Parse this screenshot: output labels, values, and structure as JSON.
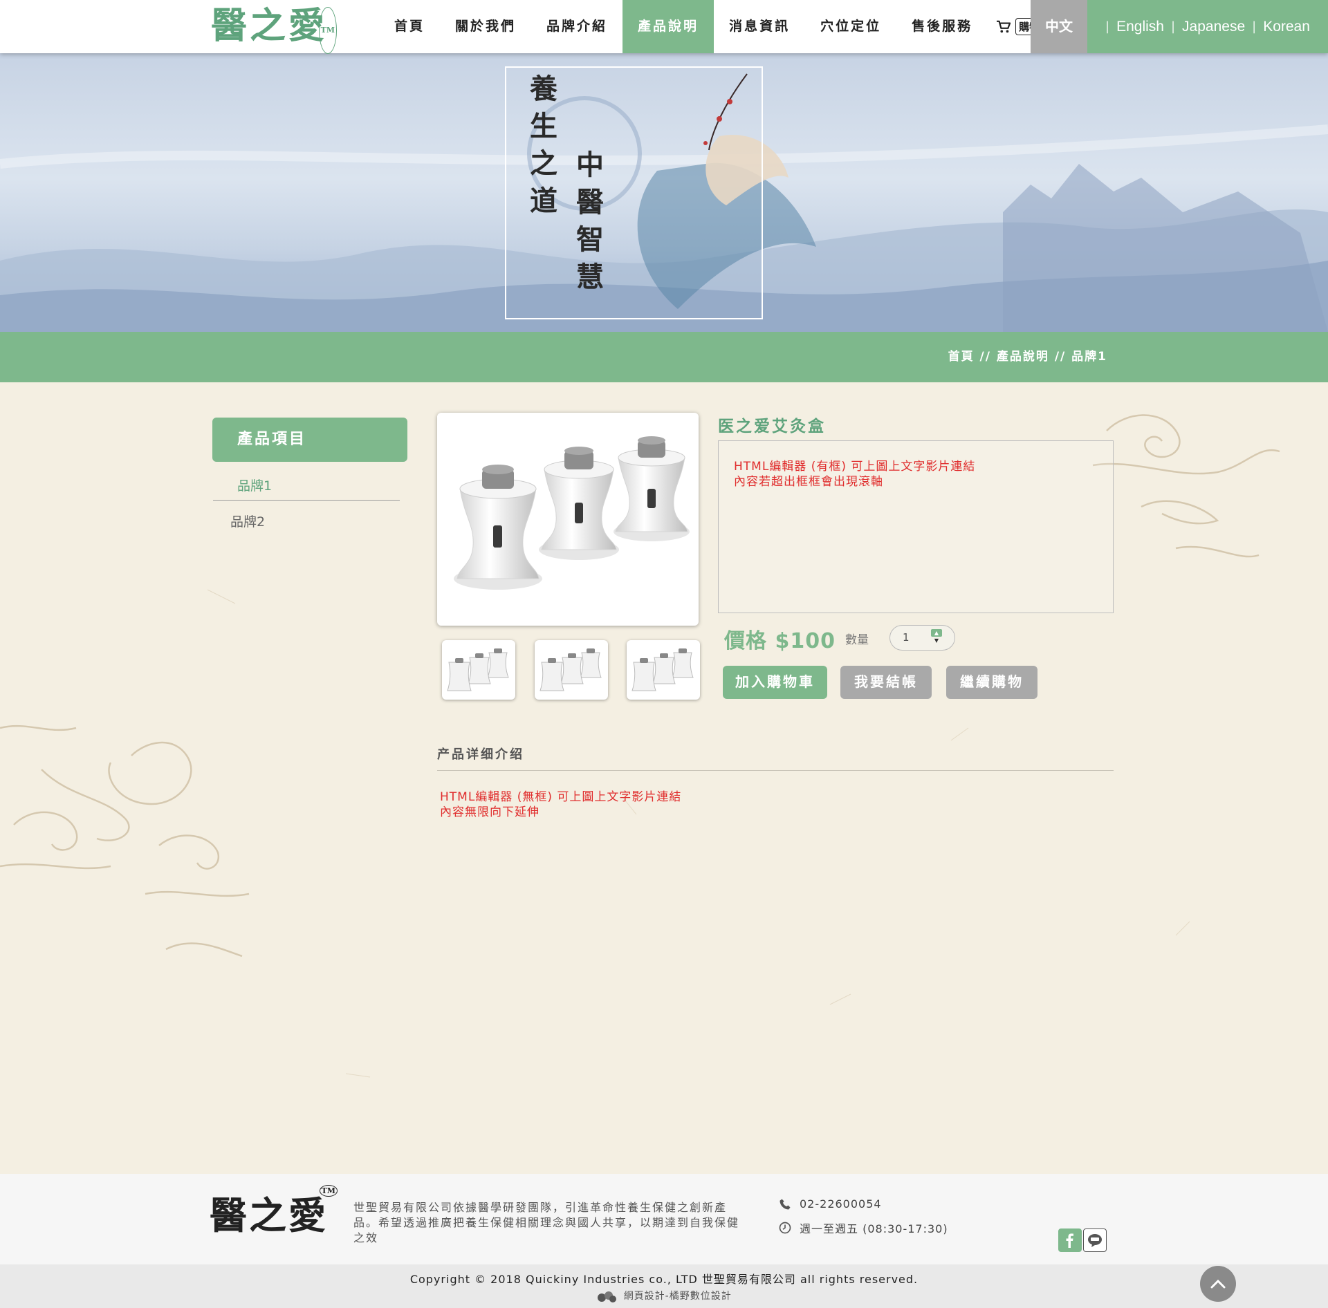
{
  "header": {
    "logo_text": "醫之愛",
    "logo_tm": "TM",
    "nav": [
      "首頁",
      "關於我們",
      "品牌介紹",
      "產品說明",
      "消息資訊",
      "穴位定位",
      "售後服務"
    ],
    "active_nav": "產品說明",
    "cart_label": "購物車",
    "languages": {
      "current": "中文",
      "en": "English",
      "ja": "Japanese",
      "ko": "Korean"
    }
  },
  "banner": {
    "text_left": "養生之道",
    "text_right": "中醫智慧"
  },
  "breadcrumb": {
    "home": "首頁",
    "section": "產品說明",
    "current": "品牌1",
    "separator": "//"
  },
  "sidebar": {
    "heading": "產品項目",
    "items": [
      "品牌1",
      "品牌2"
    ],
    "active_index": 0
  },
  "product": {
    "title": "医之爱艾灸盒",
    "description_lines": [
      "HTML編輯器 (有框) 可上圖上文字影片連結",
      "內容若超出框框會出現滾軸"
    ],
    "price_label": "價格 $100",
    "qty_label": "數量",
    "qty_value": "1",
    "buttons": {
      "add_to_cart": "加入購物車",
      "checkout": "我要結帳",
      "continue": "繼續購物"
    },
    "detail_title": "产品详细介绍",
    "detail_lines": [
      "HTML編輯器 (無框) 可上圖上文字影片連結",
      "內容無限向下延伸"
    ]
  },
  "footer": {
    "logo_text": "醫之愛",
    "logo_tm": "TM",
    "about": "世聖貿易有限公司依據醫學研發團隊，引進革命性養生保健之創新產品。希望透過推廣把養生保健相關理念與國人共享，以期達到自我保健之效",
    "phone": "02-22600054",
    "hours": "週一至週五 (08:30-17:30)",
    "copyright": "Copyright © 2018 Quickiny Industries co., LTD 世聖貿易有限公司 all rights reserved.",
    "designer": "網頁設計-橘野數位設計"
  },
  "colors": {
    "accent_green": "#7eb88c",
    "logo_green": "#5ea37c",
    "grey_button": "#a9a9a9",
    "editor_red": "#e02c2c",
    "paper": "#f4efe2"
  },
  "icons": [
    "cart-icon",
    "phone-icon",
    "clock-icon",
    "facebook-icon",
    "line-icon",
    "arrow-up-icon"
  ]
}
